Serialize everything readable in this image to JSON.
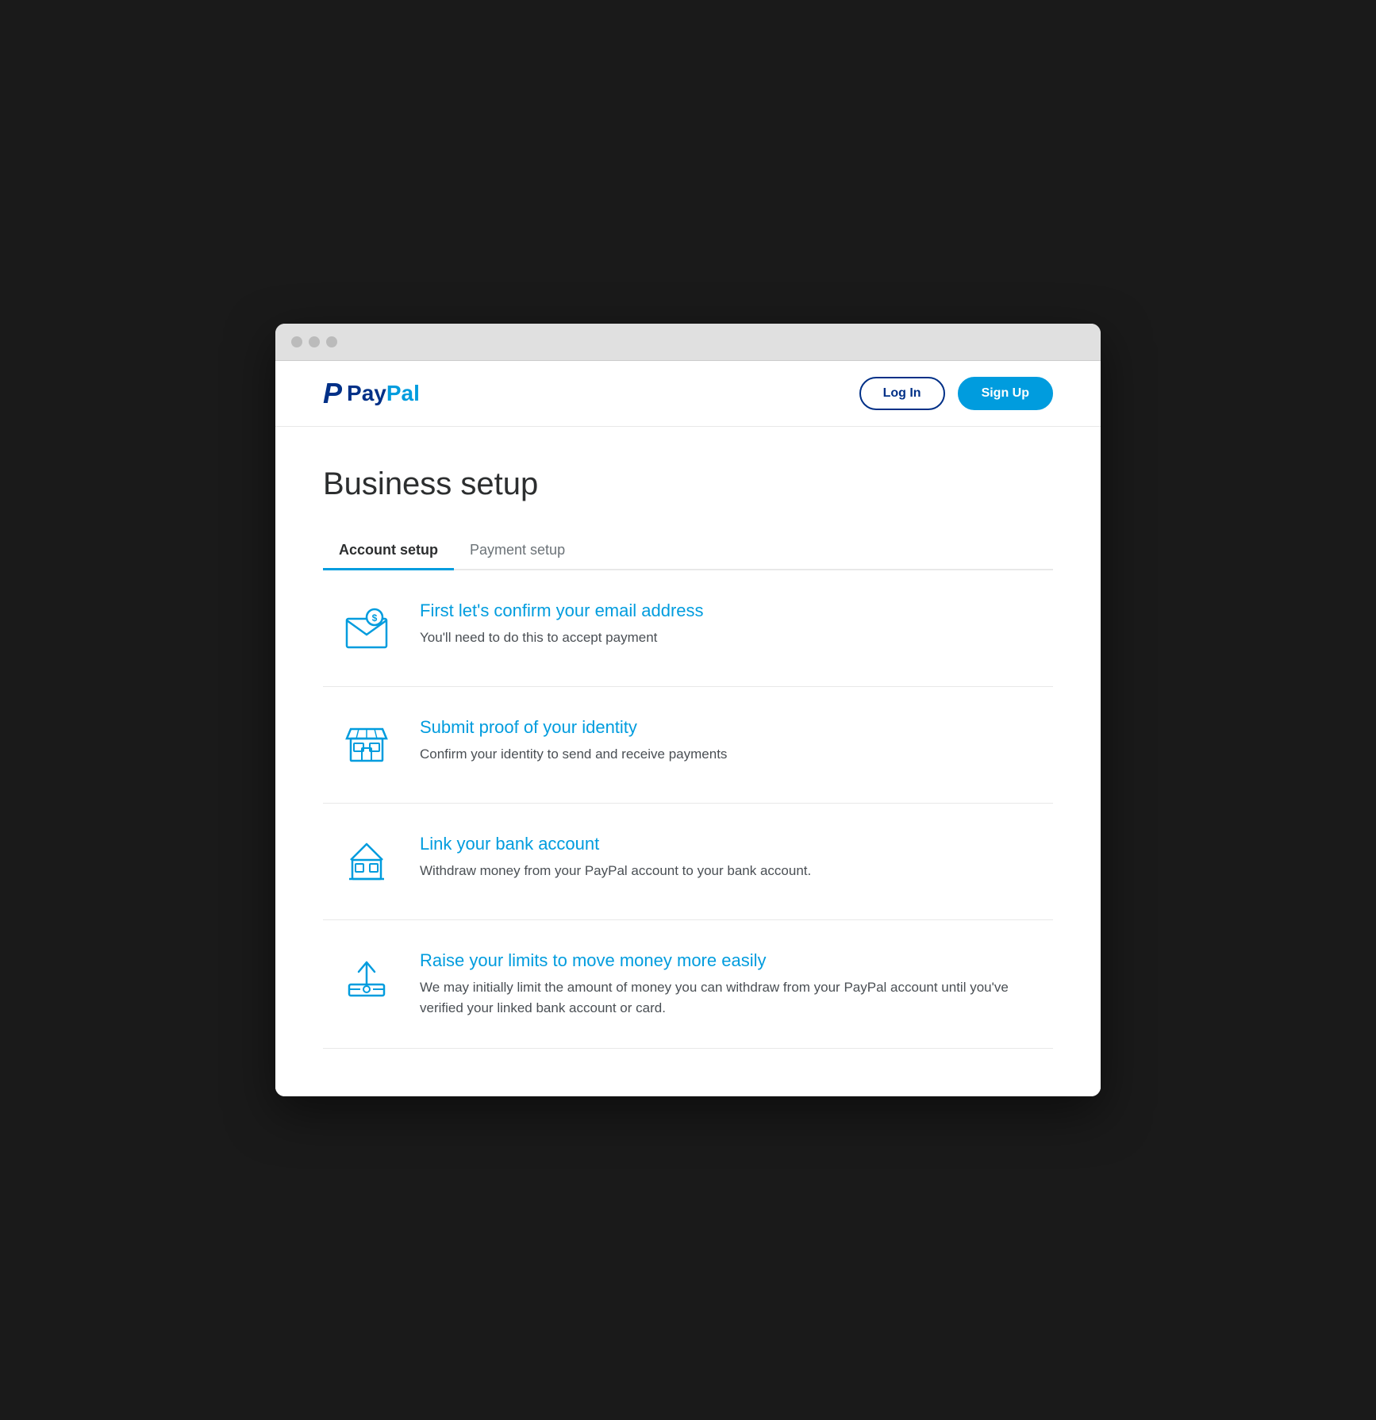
{
  "browser": {
    "traffic_lights": [
      "close",
      "minimize",
      "maximize"
    ]
  },
  "header": {
    "logo_text": "PayPal",
    "logo_pay": "Pay",
    "logo_pal": "Pal",
    "login_label": "Log In",
    "signup_label": "Sign Up"
  },
  "main": {
    "page_title": "Business setup",
    "tabs": [
      {
        "id": "account-setup",
        "label": "Account setup",
        "active": true
      },
      {
        "id": "payment-setup",
        "label": "Payment setup",
        "active": false
      }
    ],
    "setup_items": [
      {
        "id": "confirm-email",
        "title": "First let's confirm your email address",
        "description": "You'll need to do this to accept payment",
        "icon": "email"
      },
      {
        "id": "submit-identity",
        "title": "Submit proof of your identity",
        "description": "Confirm your identity to send and receive payments",
        "icon": "store"
      },
      {
        "id": "link-bank",
        "title": "Link your bank account",
        "description": "Withdraw money from your PayPal account to your bank account.",
        "icon": "bank"
      },
      {
        "id": "raise-limits",
        "title": "Raise your limits to move money more easily",
        "description": "We may initially limit the amount of money you can withdraw from your PayPal account until you've verified your linked bank account or card.",
        "icon": "upload"
      }
    ]
  }
}
